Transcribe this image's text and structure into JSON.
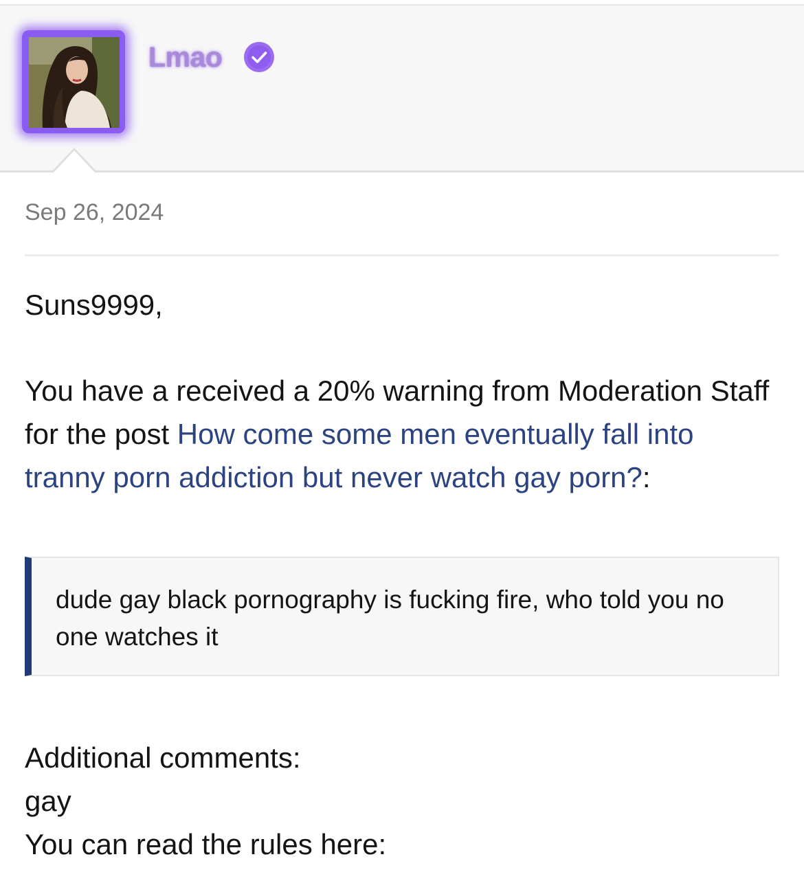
{
  "profile": {
    "username": "Lmao",
    "verified_icon": "verified-check-icon",
    "accent_color": "#8a5cf2"
  },
  "message": {
    "date": "Sep 26, 2024",
    "greeting": "Suns9999,",
    "intro_text": "You have a received a 20% warning from Moderation Staff for the post ",
    "post_link_text": "How come some men eventually fall into tranny porn addiction but never watch gay porn?",
    "post_link_suffix": ":",
    "quote_text": "dude gay black pornography is fucking fire, who told you no one watches it",
    "additional_label": "Additional comments:",
    "additional_comment": "gay",
    "rules_text": "You can read the rules here:"
  },
  "colors": {
    "link": "#2b4380",
    "quote_bar": "#223a78",
    "header_bg": "#f7f7f8"
  }
}
